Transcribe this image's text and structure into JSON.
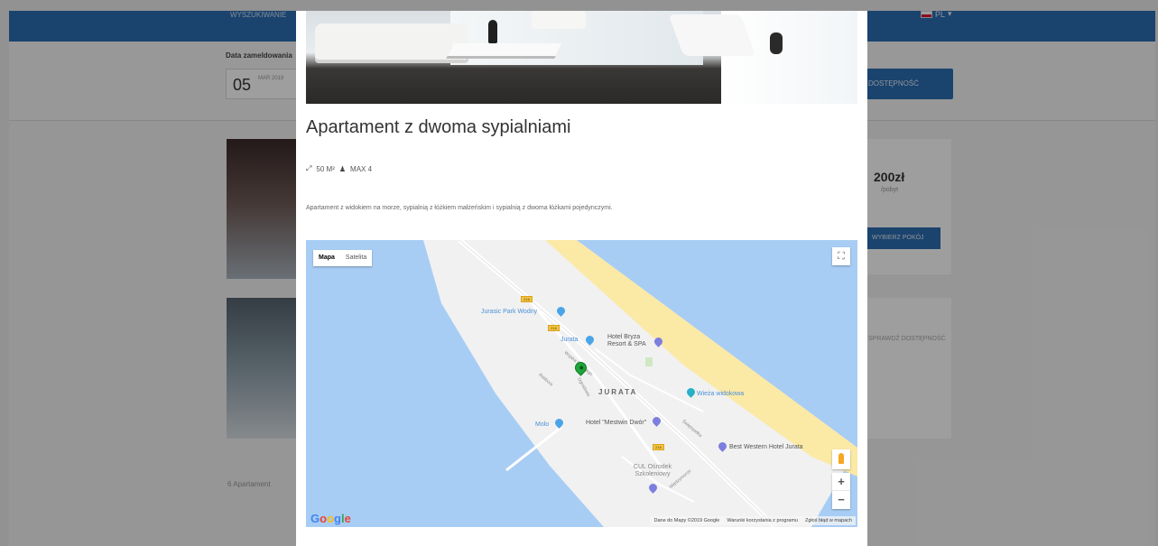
{
  "background": {
    "nav_link": "WYSZUKIWANIE",
    "language": "PL",
    "date_label": "Data zameldowania",
    "date_day": "05",
    "date_month": "MAR 2019",
    "search_button": "DOSTĘPNOŚĆ",
    "price": "200zł",
    "price_unit": "/pobyt",
    "choose_button": "WYBIERZ POKÓJ",
    "availability": "SPRAWDŹ DOSTĘPNOŚĆ",
    "rooms_label": "6 Apartament"
  },
  "modal": {
    "title": "Apartament z dwoma sypialniami",
    "area": "50 M²",
    "capacity": "MAX 4",
    "description": "Apartament z widokiem na morze, sypialnią z łóżkiem małżeńskim i sypialnią z dwoma łóżkami pojedynczymi."
  },
  "map": {
    "type_buttons": [
      "Mapa",
      "Satelita"
    ],
    "active_type": "Mapa",
    "place_name": "JURATA",
    "labels": {
      "park": "Jurasic Park Wodny",
      "jurata_station": "Jurata",
      "hotel_bryza": "Hotel Bryza Resort & SPA",
      "wieza": "Wieża widokowa",
      "molo": "Molo",
      "hotel_dwor": "Hotel \"Mestwin Dwór\"",
      "best_western": "Best Western Hotel Jurata",
      "cul": "CUL Ośrodek Szkoleniowy",
      "street1": "Wojska Polskiego",
      "street2": "Ratibora",
      "street3": "Ogrodowa",
      "street4": "Świętopełka",
      "street5": "Międzymorze"
    },
    "road_number": "216",
    "logo": "Google",
    "attribution": {
      "data": "Dane do Mapy ©2019 Google",
      "terms": "Warunki korzystania z programu",
      "report": "Zgłoś błąd w mapach"
    },
    "zoom_in": "+",
    "zoom_out": "−"
  },
  "colors": {
    "nav_blue": "#2b6db2",
    "water": "#a8cdf4",
    "land": "#f1f1f1",
    "beach": "#fbe9a6",
    "marker_green": "#1fa53a"
  },
  "icons": {
    "area": "resize-arrows-icon",
    "capacity": "person-icon",
    "fullscreen": "fullscreen-icon",
    "pegman": "street-view-icon"
  }
}
